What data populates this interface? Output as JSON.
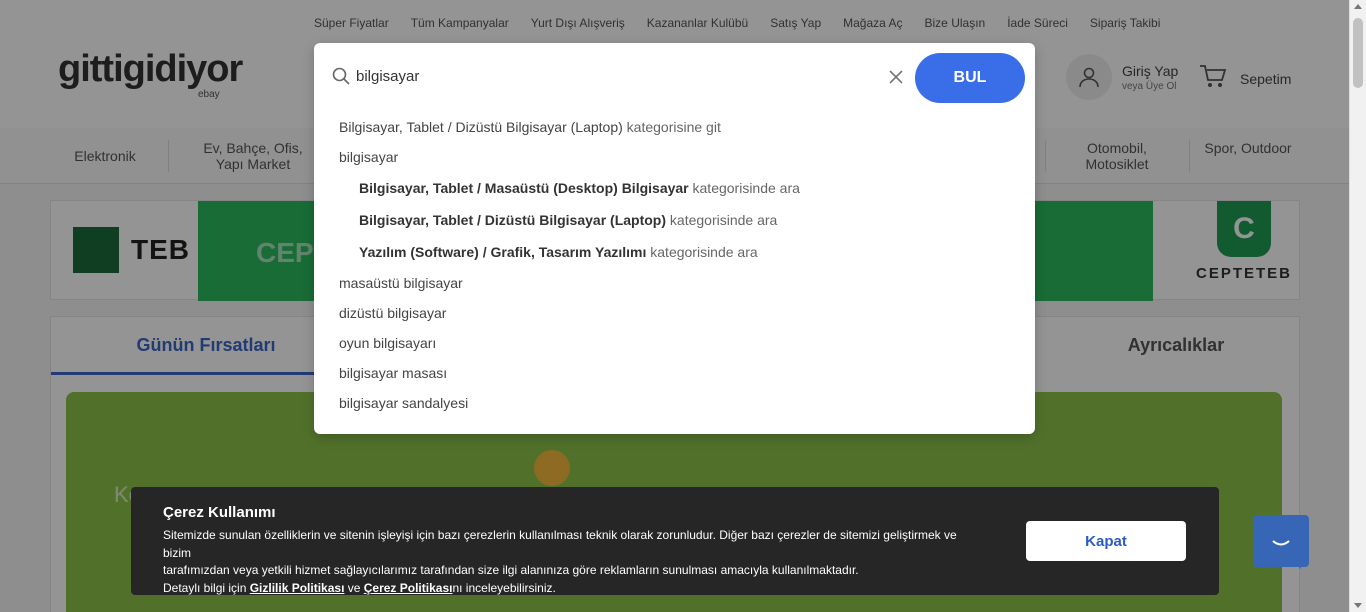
{
  "toplinks": [
    "Süper Fiyatlar",
    "Tüm Kampanyalar",
    "Yurt Dışı Alışveriş",
    "Kazananlar Kulübü",
    "Satış Yap",
    "Mağaza Aç",
    "Bize Ulaşın",
    "İade Süreci",
    "Sipariş Takibi"
  ],
  "header": {
    "logo": "gittigidiyor",
    "logo_sub": "ebay",
    "account_title": "Giriş Yap",
    "account_sub": "veya Üye Ol",
    "cart_label": "Sepetim"
  },
  "categories": [
    {
      "label": "Elektronik"
    },
    {
      "label": "Ev, Bahçe, Ofis, Yapı Market"
    },
    {
      "label": "Otomobil, Motosiklet"
    },
    {
      "label": "Spor, Outdoor"
    }
  ],
  "banner": {
    "teb": "TEB",
    "cepte_partial": "CEPT",
    "cepteteb": "CEPTETEB",
    "shield_letter": "C"
  },
  "tabs": {
    "active": "Günün Fırsatları",
    "right": "Ayrıcalıklar"
  },
  "search": {
    "value": "bilgisayar",
    "button_label": "BUL",
    "suggestions": [
      {
        "bold": "",
        "plain": "Bilgisayar, Tablet / Dizüstü Bilgisayar (Laptop)",
        "suffix": " kategorisine git",
        "sub": false
      },
      {
        "bold": "",
        "plain": "bilgisayar",
        "suffix": "",
        "sub": false
      },
      {
        "bold": "Bilgisayar, Tablet / Masaüstü (Desktop) Bilgisayar",
        "plain": "",
        "suffix": " kategorisinde ara",
        "sub": true
      },
      {
        "bold": "Bilgisayar, Tablet / Dizüstü Bilgisayar (Laptop)",
        "plain": "",
        "suffix": " kategorisinde ara",
        "sub": true
      },
      {
        "bold": "Yazılım (Software) / Grafik, Tasarım Yazılımı",
        "plain": "",
        "suffix": " kategorisinde ara",
        "sub": true
      },
      {
        "bold": "",
        "plain": "masaüstü bilgisayar",
        "suffix": "",
        "sub": false
      },
      {
        "bold": "",
        "plain": "dizüstü bilgisayar",
        "suffix": "",
        "sub": false
      },
      {
        "bold": "",
        "plain": "oyun bilgisayarı",
        "suffix": "",
        "sub": false
      },
      {
        "bold": "",
        "plain": "bilgisayar masası",
        "suffix": "",
        "sub": false
      },
      {
        "bold": "",
        "plain": "bilgisayar sandalyesi",
        "suffix": "",
        "sub": false
      }
    ]
  },
  "cookie": {
    "title": "Çerez Kullanımı",
    "line1": "Sitemizde sunulan özelliklerin ve sitenin işleyişi için bazı çerezlerin kullanılması teknik olarak zorunludur. Diğer bazı çerezler de sitemizi geliştirmek ve bizim",
    "line2": "tarafımızdan veya yetkili hizmet sağlayıcılarımız tarafından size ilgi alanınıza göre reklamların sunulması amacıyla kullanılmaktadır.",
    "line3_pre": "Detaylı bilgi için ",
    "privacy_link": "Gizlilik Politikası",
    "line3_mid": " ve ",
    "cookie_link": "Çerez Politikası",
    "line3_post": "nı inceleyebilirsiniz.",
    "close_label": "Kapat"
  },
  "promo_ghost": "Ko",
  "colors": {
    "accent": "#3a6ee8",
    "tab_active": "#3c67c8",
    "cookie_bg": "#262626",
    "chat": "#3766b7"
  }
}
